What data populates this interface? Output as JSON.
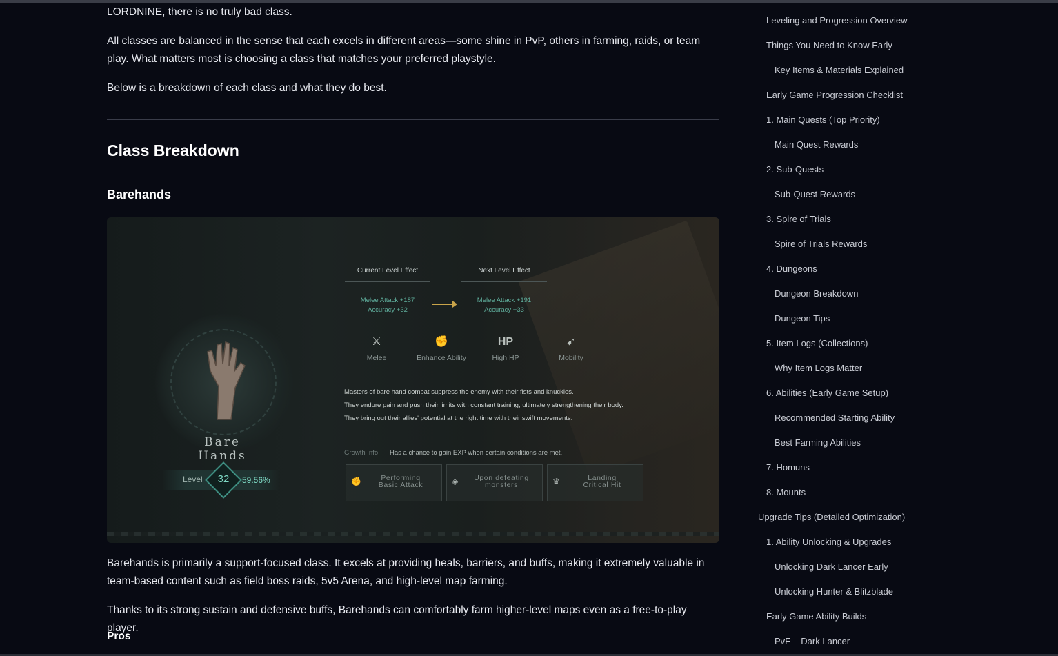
{
  "article": {
    "intro_tail": "LORDNINE, there is no truly bad class.",
    "para_balanced": "All classes are balanced in the sense that each excels in different areas—some shine in PvP, others in farming, raids, or team play. What matters most is choosing a class that matches your preferred playstyle.",
    "para_breakdown": "Below is a breakdown of each class and what they do best.",
    "heading_class_breakdown": "Class Breakdown",
    "heading_barehands": "Barehands",
    "para_support": "Barehands is primarily a support-focused class. It excels at providing heals, barriers, and buffs, making it extremely valuable in team-based content such as field boss raids, 5v5 Arena, and high-level map farming.",
    "para_sustain": "Thanks to its strong sustain and defensive buffs, Barehands can comfortably farm higher-level maps even as a free-to-play player.",
    "pros_label": "Pros"
  },
  "figure": {
    "class_name": "Bare Hands",
    "level_label": "Level",
    "level_value": "32",
    "level_percent": "59.56%",
    "current_title": "Current Level Effect",
    "next_title": "Next Level Effect",
    "current_line1": "Melee Attack +187",
    "current_line2": "Accuracy +32",
    "next_line1": "Melee Attack +191",
    "next_line2": "Accuracy +33",
    "stats": [
      "Melee",
      "Enhance Ability",
      "High HP",
      "Mobility"
    ],
    "hp_icon_text": "HP",
    "desc_line1": "Masters of bare hand combat suppress the enemy with their fists and knuckles.",
    "desc_line2": "They endure pain and push their limits with constant training, ultimately strengthening their body.",
    "desc_line3": "They bring out their allies' potential at the right time with their swift movements.",
    "growth_label": "Growth Info",
    "growth_text": "Has a chance to gain EXP when certain conditions are met.",
    "box1_line1": "Performing",
    "box1_line2": "Basic Attack",
    "box2_line1": "Upon defeating",
    "box2_line2": "monsters",
    "box3_line1": "Landing",
    "box3_line2": "Critical Hit"
  },
  "toc": {
    "items": [
      "Leveling and Progression Overview",
      "Things You Need to Know Early",
      "Key Items & Materials Explained",
      "Early Game Progression Checklist",
      "1. Main Quests (Top Priority)",
      "Main Quest Rewards",
      "2. Sub-Quests",
      "Sub-Quest Rewards",
      "3. Spire of Trials",
      "Spire of Trials Rewards",
      "4. Dungeons",
      "Dungeon Breakdown",
      "Dungeon Tips",
      "5. Item Logs (Collections)",
      "Why Item Logs Matter",
      "6. Abilities (Early Game Setup)",
      "Recommended Starting Ability",
      "Best Farming Abilities",
      "7. Homuns",
      "8. Mounts",
      "Upgrade Tips (Detailed Optimization)",
      "1. Ability Unlocking & Upgrades",
      "Unlocking Dark Lancer Early",
      "Unlocking Hunter & Blitzblade",
      "Early Game Ability Builds",
      "PvE – Dark Lancer"
    ]
  }
}
